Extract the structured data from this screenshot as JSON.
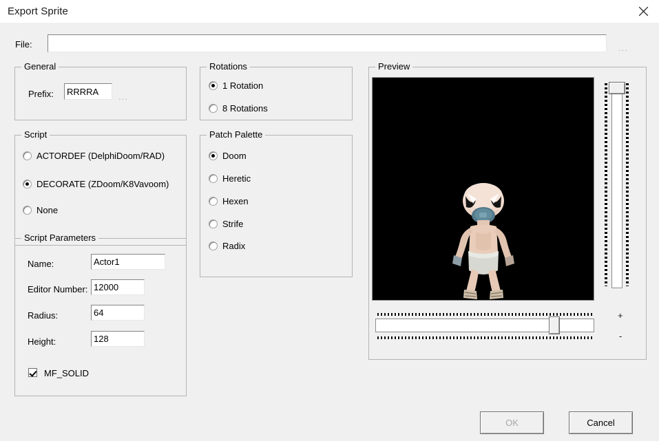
{
  "window": {
    "title": "Export Sprite",
    "close_icon": "close-icon"
  },
  "file_row": {
    "label": "File:",
    "value": "",
    "placeholder": "",
    "browse_label": "..."
  },
  "general": {
    "title": "General",
    "prefix_label": "Prefix:",
    "prefix_value": "RRRRA",
    "browse_label": "..."
  },
  "script": {
    "title": "Script",
    "options": [
      {
        "label": "ACTORDEF (DelphiDoom/RAD)",
        "checked": false
      },
      {
        "label": "DECORATE (ZDoom/K8Vavoom)",
        "checked": true
      },
      {
        "label": "None",
        "checked": false
      }
    ]
  },
  "script_parameters": {
    "title": "Script Parameters",
    "fields": [
      {
        "label": "Name:",
        "value": "Actor1"
      },
      {
        "label": "Editor Number:",
        "value": "12000"
      },
      {
        "label": "Radius:",
        "value": "64"
      },
      {
        "label": "Height:",
        "value": "128"
      }
    ],
    "flag": {
      "label": "MF_SOLID",
      "checked": true
    }
  },
  "rotations": {
    "title": "Rotations",
    "options": [
      {
        "label": "1 Rotation",
        "checked": true
      },
      {
        "label": "8 Rotations",
        "checked": false
      }
    ]
  },
  "patch_palette": {
    "title": "Patch Palette",
    "options": [
      {
        "label": "Doom",
        "checked": true
      },
      {
        "label": "Heretic",
        "checked": false
      },
      {
        "label": "Hexen",
        "checked": false
      },
      {
        "label": "Strife",
        "checked": false
      },
      {
        "label": "Radix",
        "checked": false
      }
    ]
  },
  "preview": {
    "title": "Preview",
    "canvas_background": "#000000",
    "zoom_in_label": "+",
    "zoom_out_label": "-"
  },
  "footer": {
    "ok_label": "OK",
    "ok_disabled": true,
    "cancel_label": "Cancel"
  }
}
